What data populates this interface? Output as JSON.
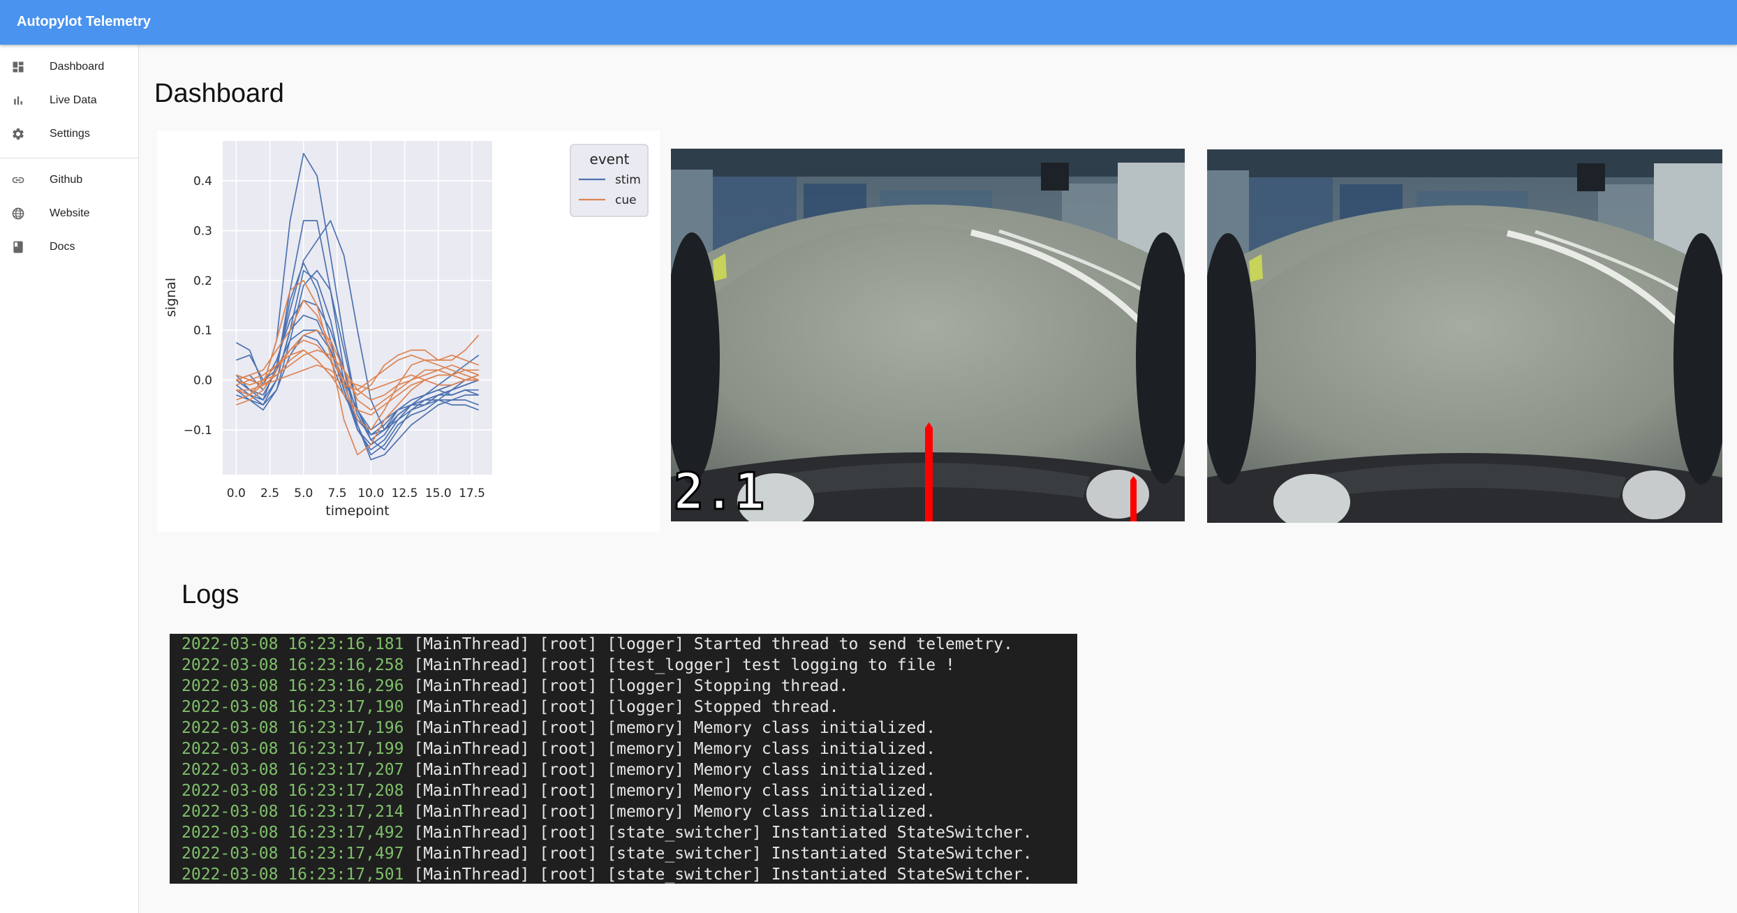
{
  "app": {
    "title": "Autopylot Telemetry"
  },
  "nav": {
    "main": [
      {
        "label": "Dashboard",
        "icon": "dashboard-icon"
      },
      {
        "label": "Live Data",
        "icon": "bar-chart-icon"
      },
      {
        "label": "Settings",
        "icon": "gear-icon"
      }
    ],
    "links": [
      {
        "label": "Github",
        "icon": "link-icon"
      },
      {
        "label": "Website",
        "icon": "globe-icon"
      },
      {
        "label": "Docs",
        "icon": "book-icon"
      }
    ]
  },
  "page": {
    "title": "Dashboard",
    "logs_title": "Logs"
  },
  "camera": {
    "left_overlay": "2.1"
  },
  "colors": {
    "appbar": "#4a93ee",
    "stim": "#4c72b0",
    "cue": "#dd8452",
    "log_timestamp": "#7fbf6a",
    "steering_marker": "#ff0000"
  },
  "chart_data": {
    "type": "line",
    "xlabel": "timepoint",
    "ylabel": "signal",
    "xlim": [
      -1,
      19
    ],
    "ylim": [
      -0.19,
      0.48
    ],
    "xticks": [
      0.0,
      2.5,
      5.0,
      7.5,
      10.0,
      12.5,
      15.0,
      17.5
    ],
    "xtick_labels": [
      "0.0",
      "2.5",
      "5.0",
      "7.5",
      "10.0",
      "12.5",
      "15.0",
      "17.5"
    ],
    "yticks": [
      -0.1,
      0.0,
      0.1,
      0.2,
      0.3,
      0.4
    ],
    "ytick_labels": [
      "−0.1",
      "0.0",
      "0.1",
      "0.2",
      "0.3",
      "0.4"
    ],
    "grid": true,
    "legend": {
      "title": "event",
      "position": "top-right",
      "entries": [
        "stim",
        "cue"
      ]
    },
    "x": [
      0,
      1,
      2,
      3,
      4,
      5,
      6,
      7,
      8,
      9,
      10,
      11,
      12,
      13,
      14,
      15,
      16,
      17,
      18
    ],
    "series": [
      {
        "name": "stim",
        "values": [
          0.075,
          0.06,
          -0.01,
          0.08,
          0.32,
          0.455,
          0.41,
          0.25,
          0.08,
          -0.06,
          -0.11,
          -0.09,
          -0.06,
          -0.04,
          -0.03,
          -0.01,
          0.01,
          0.03,
          0.05
        ]
      },
      {
        "name": "stim",
        "values": [
          0.04,
          0.05,
          0.0,
          0.02,
          0.18,
          0.32,
          0.32,
          0.18,
          0.02,
          -0.09,
          -0.15,
          -0.13,
          -0.09,
          -0.07,
          -0.06,
          -0.04,
          -0.02,
          0.0,
          0.01
        ]
      },
      {
        "name": "stim",
        "values": [
          0.01,
          -0.02,
          -0.04,
          0.03,
          0.14,
          0.24,
          0.28,
          0.32,
          0.25,
          0.1,
          -0.04,
          -0.1,
          -0.08,
          -0.05,
          -0.03,
          -0.02,
          -0.01,
          0.0,
          0.0
        ]
      },
      {
        "name": "stim",
        "values": [
          -0.01,
          -0.03,
          -0.05,
          0.0,
          0.1,
          0.22,
          0.2,
          0.12,
          0.0,
          -0.1,
          -0.14,
          -0.12,
          -0.08,
          -0.06,
          -0.04,
          -0.03,
          -0.02,
          -0.01,
          0.0
        ]
      },
      {
        "name": "stim",
        "values": [
          0.0,
          -0.02,
          -0.03,
          0.02,
          0.16,
          0.235,
          0.18,
          0.08,
          -0.02,
          -0.1,
          -0.13,
          -0.11,
          -0.07,
          -0.05,
          -0.04,
          -0.03,
          -0.02,
          -0.01,
          0.0
        ]
      },
      {
        "name": "stim",
        "values": [
          -0.02,
          -0.04,
          -0.06,
          -0.02,
          0.08,
          0.19,
          0.22,
          0.18,
          0.06,
          -0.06,
          -0.12,
          -0.1,
          -0.06,
          -0.04,
          -0.03,
          -0.02,
          -0.03,
          -0.02,
          -0.03
        ]
      },
      {
        "name": "stim",
        "values": [
          0.01,
          0.0,
          -0.01,
          0.04,
          0.12,
          0.16,
          0.15,
          0.1,
          0.02,
          -0.07,
          -0.12,
          -0.14,
          -0.1,
          -0.06,
          -0.05,
          -0.03,
          -0.03,
          -0.02,
          -0.02
        ]
      },
      {
        "name": "stim",
        "values": [
          -0.02,
          -0.03,
          -0.04,
          0.0,
          0.1,
          0.13,
          0.12,
          0.06,
          -0.02,
          -0.09,
          -0.16,
          -0.15,
          -0.12,
          -0.09,
          -0.07,
          -0.05,
          -0.04,
          -0.03,
          -0.03
        ]
      },
      {
        "name": "stim",
        "values": [
          0.0,
          0.01,
          -0.02,
          0.02,
          0.08,
          0.1,
          0.1,
          0.06,
          0.0,
          -0.06,
          -0.1,
          -0.08,
          -0.06,
          -0.05,
          -0.04,
          -0.04,
          -0.05,
          -0.05,
          -0.06
        ]
      },
      {
        "name": "stim",
        "values": [
          -0.03,
          -0.04,
          -0.05,
          -0.02,
          0.05,
          0.09,
          0.08,
          0.04,
          -0.03,
          -0.08,
          -0.11,
          -0.1,
          -0.07,
          -0.05,
          -0.05,
          -0.04,
          -0.04,
          -0.04,
          -0.05
        ]
      },
      {
        "name": "cue",
        "values": [
          -0.02,
          -0.03,
          -0.01,
          0.08,
          0.18,
          0.2,
          0.15,
          0.05,
          -0.08,
          -0.15,
          -0.13,
          -0.08,
          -0.05,
          -0.02,
          0.0,
          0.01,
          0.01,
          0.0,
          0.0
        ]
      },
      {
        "name": "cue",
        "values": [
          0.0,
          0.01,
          0.02,
          0.06,
          0.1,
          0.16,
          0.13,
          0.07,
          -0.01,
          -0.08,
          -0.1,
          -0.06,
          -0.01,
          0.03,
          0.04,
          0.03,
          0.02,
          0.01,
          0.0
        ]
      },
      {
        "name": "cue",
        "values": [
          -0.04,
          -0.03,
          0.0,
          0.03,
          0.06,
          0.08,
          0.07,
          0.04,
          0.0,
          -0.03,
          -0.01,
          0.03,
          0.05,
          0.06,
          0.06,
          0.04,
          0.04,
          0.06,
          0.09
        ]
      },
      {
        "name": "cue",
        "values": [
          -0.01,
          0.0,
          0.01,
          0.03,
          0.05,
          0.06,
          0.04,
          0.01,
          -0.01,
          -0.02,
          0.0,
          0.02,
          0.04,
          0.05,
          0.04,
          0.04,
          0.05,
          0.04,
          0.03
        ]
      },
      {
        "name": "cue",
        "values": [
          -0.05,
          -0.04,
          -0.02,
          0.02,
          0.06,
          0.09,
          0.1,
          0.08,
          0.02,
          -0.04,
          -0.06,
          -0.04,
          -0.02,
          0.0,
          0.01,
          0.02,
          0.01,
          0.0,
          0.01
        ]
      },
      {
        "name": "cue",
        "values": [
          0.0,
          -0.01,
          0.0,
          0.01,
          0.03,
          0.05,
          0.06,
          0.05,
          0.02,
          -0.02,
          -0.04,
          -0.03,
          -0.01,
          0.0,
          0.02,
          0.02,
          0.03,
          0.02,
          0.01
        ]
      },
      {
        "name": "cue",
        "values": [
          -0.02,
          -0.02,
          -0.01,
          0.0,
          0.01,
          0.02,
          0.03,
          0.02,
          0.0,
          -0.01,
          -0.02,
          -0.01,
          0.0,
          0.01,
          0.0,
          -0.01,
          -0.01,
          0.0,
          0.0
        ]
      },
      {
        "name": "cue",
        "values": [
          0.01,
          0.0,
          -0.01,
          0.01,
          0.04,
          0.06,
          0.04,
          0.01,
          -0.03,
          -0.06,
          -0.07,
          -0.05,
          -0.03,
          -0.01,
          0.0,
          0.01,
          0.01,
          0.02,
          0.02
        ]
      }
    ]
  },
  "logs": [
    {
      "ts": "2022-03-08 16:23:16,181",
      "msg": " [MainThread] [root] [logger] Started thread to send telemetry."
    },
    {
      "ts": "2022-03-08 16:23:16,258",
      "msg": " [MainThread] [root] [test_logger] test logging to file !"
    },
    {
      "ts": "2022-03-08 16:23:16,296",
      "msg": " [MainThread] [root] [logger] Stopping thread."
    },
    {
      "ts": "2022-03-08 16:23:17,190",
      "msg": " [MainThread] [root] [logger] Stopped thread."
    },
    {
      "ts": "2022-03-08 16:23:17,196",
      "msg": " [MainThread] [root] [memory] Memory class initialized."
    },
    {
      "ts": "2022-03-08 16:23:17,199",
      "msg": " [MainThread] [root] [memory] Memory class initialized."
    },
    {
      "ts": "2022-03-08 16:23:17,207",
      "msg": " [MainThread] [root] [memory] Memory class initialized."
    },
    {
      "ts": "2022-03-08 16:23:17,208",
      "msg": " [MainThread] [root] [memory] Memory class initialized."
    },
    {
      "ts": "2022-03-08 16:23:17,214",
      "msg": " [MainThread] [root] [memory] Memory class initialized."
    },
    {
      "ts": "2022-03-08 16:23:17,492",
      "msg": " [MainThread] [root] [state_switcher] Instantiated StateSwitcher."
    },
    {
      "ts": "2022-03-08 16:23:17,497",
      "msg": " [MainThread] [root] [state_switcher] Instantiated StateSwitcher."
    },
    {
      "ts": "2022-03-08 16:23:17,501",
      "msg": " [MainThread] [root] [state_switcher] Instantiated StateSwitcher."
    }
  ]
}
